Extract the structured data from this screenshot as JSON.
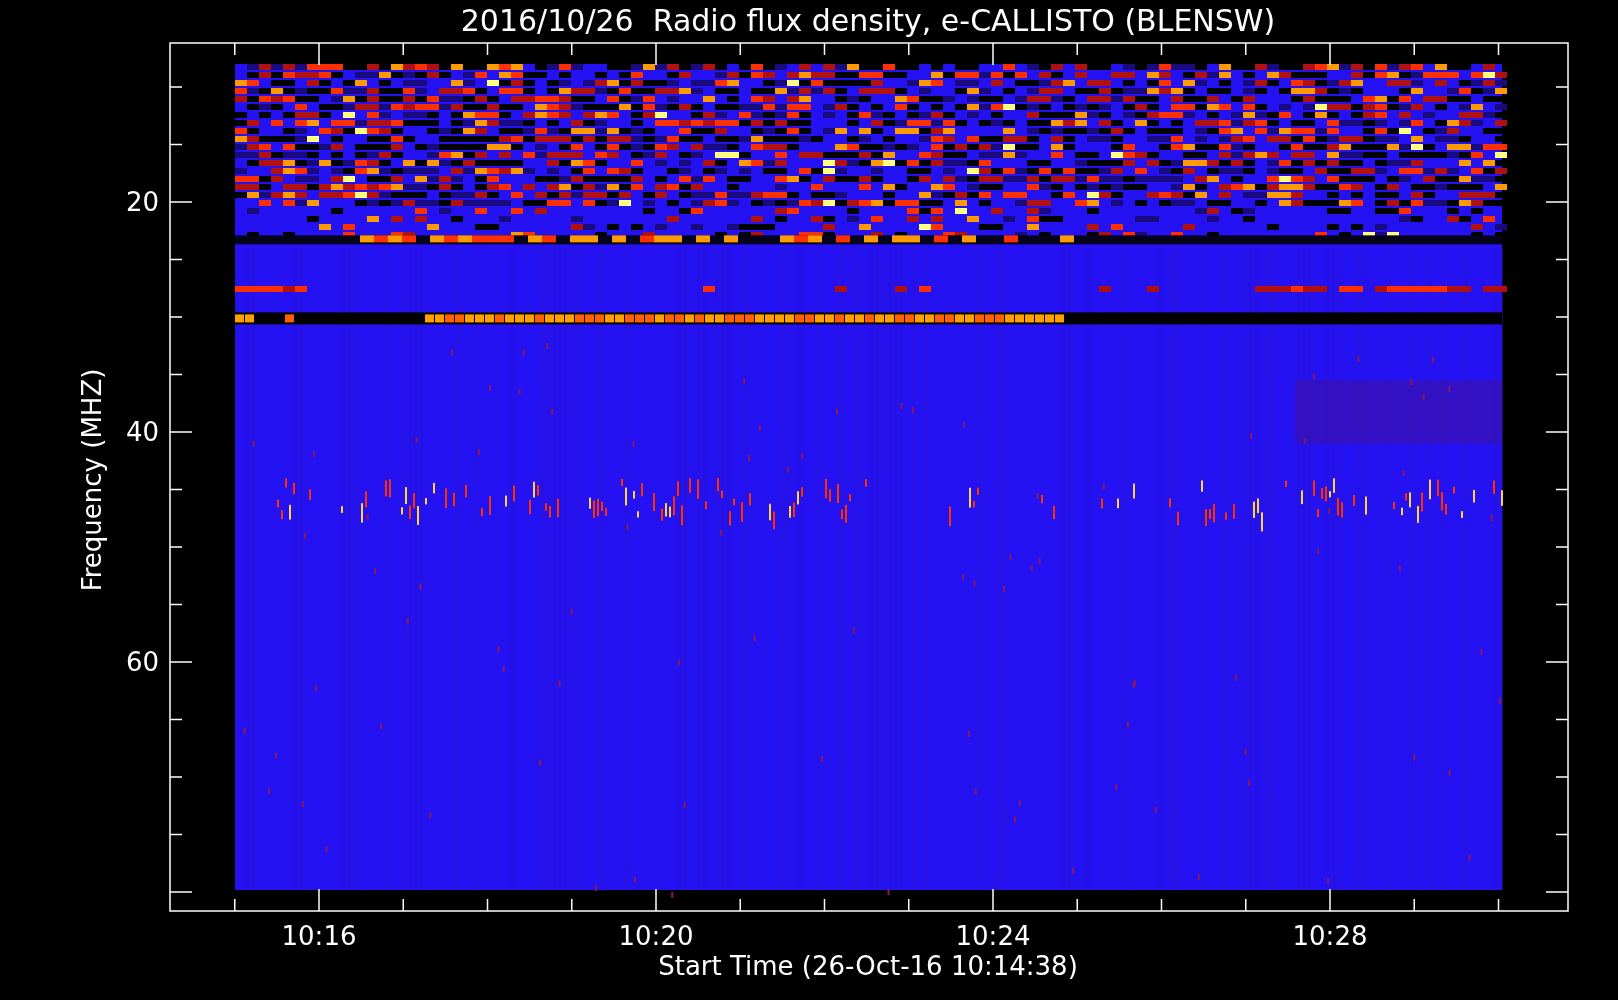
{
  "title": "2016/10/26  Radio flux density, e-CALLISTO (BLENSW)",
  "y_axis": {
    "label": "Frequency (MHZ)",
    "ticks": [
      "20",
      "40",
      "60"
    ]
  },
  "x_axis": {
    "label": "Start Time (26-Oct-16 10:14:38)",
    "ticks": [
      "10:16",
      "10:20",
      "10:24",
      "10:28"
    ]
  }
}
